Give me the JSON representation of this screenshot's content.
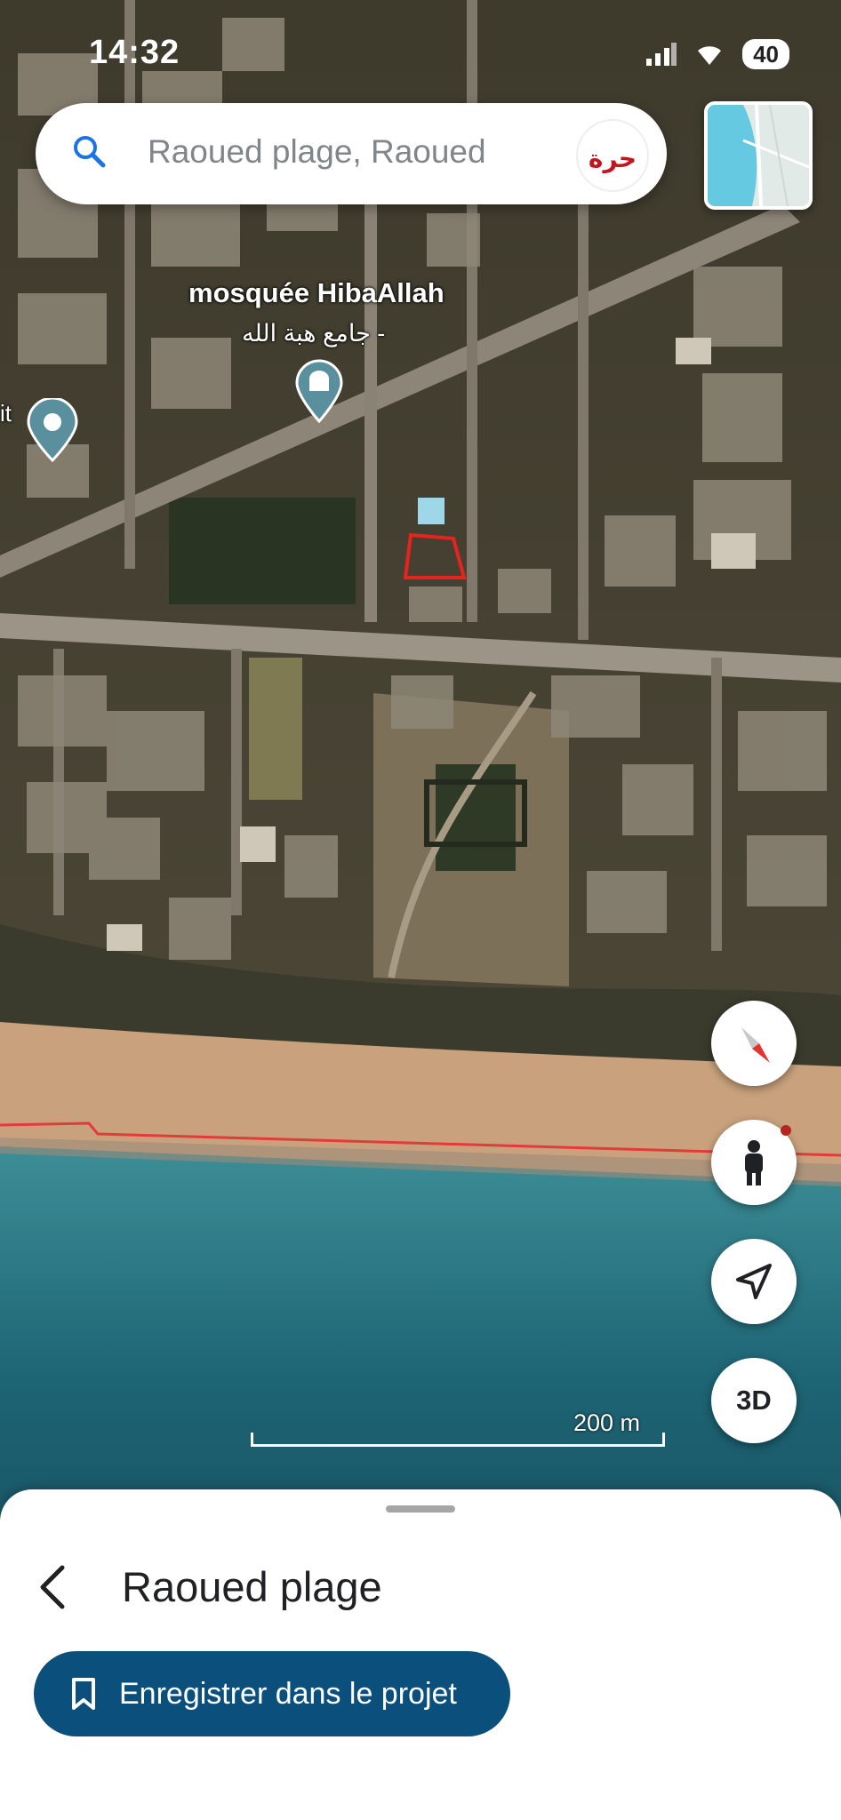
{
  "status_bar": {
    "time": "14:32",
    "battery": "40"
  },
  "search": {
    "query": "Raoued plage, Raoued",
    "icon": "search-icon"
  },
  "avatar": {
    "text": "حرة"
  },
  "map": {
    "type": "satellite",
    "poi": {
      "name": "mosquée HibaAllah",
      "name_ar": "جامع هبة الله -",
      "icon": "mosque-icon"
    },
    "partial_label": "it",
    "scale_label": "200 m",
    "parcel_outline_color": "#e8231d",
    "coastline_color": "#e23b3b"
  },
  "controls": {
    "compass": "compass-icon",
    "pegman": "pegman-icon",
    "locate": "navigation-arrow-icon",
    "three_d": "3D"
  },
  "sheet": {
    "title": "Raoued plage",
    "save_label": "Enregistrer dans le projet"
  },
  "colors": {
    "accent": "#0b4f7d",
    "sea": "#1d6474",
    "sand": "#c8a27c"
  }
}
